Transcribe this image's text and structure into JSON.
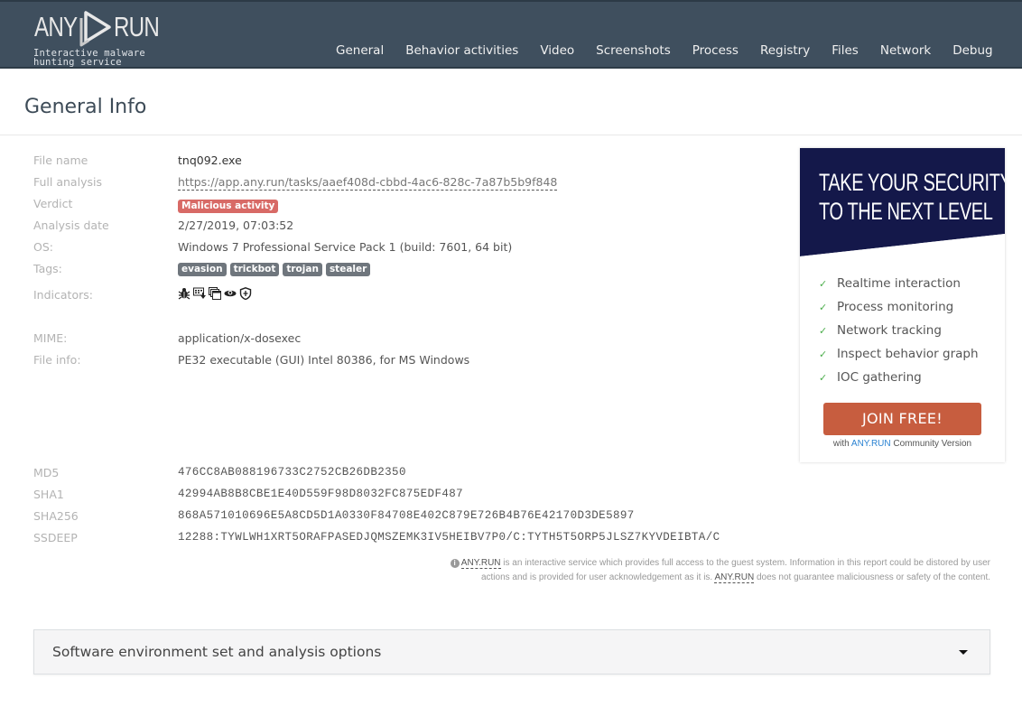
{
  "header": {
    "logo_left": "ANY",
    "logo_right": "RUN",
    "tagline": "Interactive malware hunting service",
    "nav": [
      "General",
      "Behavior activities",
      "Video",
      "Screenshots",
      "Process",
      "Registry",
      "Files",
      "Network",
      "Debug"
    ]
  },
  "page": {
    "title": "General Info"
  },
  "info": {
    "file_name": {
      "label": "File name",
      "value": "tnq092.exe"
    },
    "full_analysis": {
      "label": "Full analysis",
      "value": "https://app.any.run/tasks/aaef408d-cbbd-4ac6-828c-7a87b5b9f848"
    },
    "verdict": {
      "label": "Verdict",
      "value": "Malicious activity",
      "color": "#d86a66"
    },
    "analysis_date": {
      "label": "Analysis date",
      "value": "2/27/2019, 07:03:52"
    },
    "os": {
      "label": "OS:",
      "value": "Windows 7 Professional Service Pack 1 (build: 7601, 64 bit)"
    },
    "tags": {
      "label": "Tags:",
      "values": [
        "evasion",
        "trickbot",
        "trojan",
        "stealer"
      ]
    },
    "indicators": {
      "label": "Indicators:",
      "icons": [
        "bug-icon",
        "network-download-icon",
        "windows-stack-icon",
        "eye-icon",
        "shield-icon"
      ]
    },
    "mime": {
      "label": "MIME:",
      "value": "application/x-dosexec"
    },
    "file_info": {
      "label": "File info:",
      "value": "PE32 executable (GUI) Intel 80386, for MS Windows"
    },
    "md5": {
      "label": "MD5",
      "value": "476CC8AB088196733C2752CB26DB2350"
    },
    "sha1": {
      "label": "SHA1",
      "value": "42994AB8B8CBE1E40D559F98D8032FC875EDF487"
    },
    "sha256": {
      "label": "SHA256",
      "value": "868A571010696E5A8CD5D1A0330F84708E402C879E726B4B76E42170D3DE5897"
    },
    "ssdeep": {
      "label": "SSDEEP",
      "value": "12288:TYWLWH1XRT5ORAFPASEDJQMSZEMK3IV5HEIBV7P0/C:TYTH5T5ORP5JLSZ7KYVDEIBTA/C"
    }
  },
  "disclaimer": {
    "brand": "ANY.RUN",
    "part1": " is an interactive service which provides full access to the guest system. Information in this report could be distored by user actions and is provided for user acknowledgement as it is. ",
    "part2": " does not guarantee maliciousness or safety of the content."
  },
  "promo": {
    "headline_line1": "TAKE YOUR SECURITY",
    "headline_line2": "TO THE NEXT LEVEL",
    "features": [
      "Realtime interaction",
      "Process monitoring",
      "Network tracking",
      "Inspect behavior graph",
      "IOC gathering"
    ],
    "check_mark": "✓",
    "cta": "JOIN FREE!",
    "sub_prefix": "with ",
    "sub_brand": "ANY.RUN",
    "sub_suffix": " Community Version",
    "colors": {
      "banner": "#14184a",
      "cta": "#c75d3f",
      "check": "#4cae4c",
      "brand_link": "#2c83d2"
    }
  },
  "accordion": {
    "title": "Software environment set and analysis options"
  },
  "colors": {
    "header_bg": "#3f4f5e"
  }
}
